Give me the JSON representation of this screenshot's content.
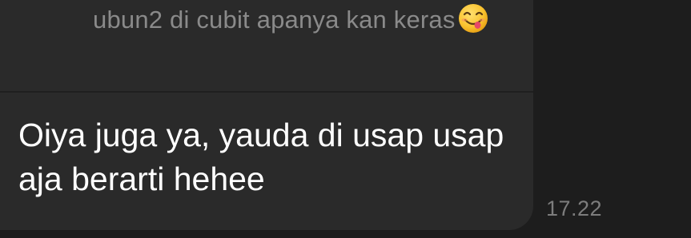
{
  "colors": {
    "background": "#1d1d1d",
    "bubble": "#2a2a2a",
    "reply_text": "#8a8a8a",
    "message_text": "#ffffff",
    "timestamp": "#7d7d7d"
  },
  "reply": {
    "text": "ubun2 di cubit apanya kan keras",
    "emoji_icon": "face-savoring-food-icon"
  },
  "message": {
    "text": "Oiya juga ya, yauda di usap usap aja berarti hehee",
    "time": "17.22"
  }
}
